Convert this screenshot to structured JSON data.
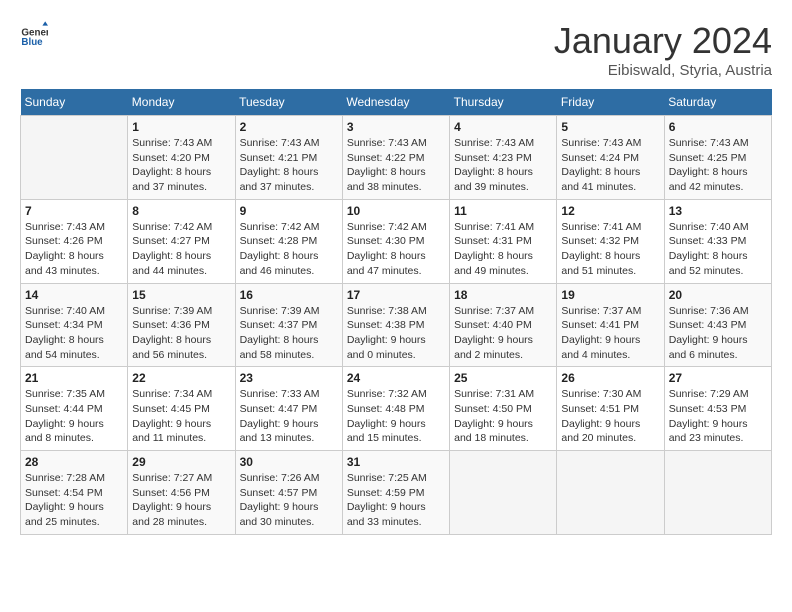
{
  "header": {
    "logo_general": "General",
    "logo_blue": "Blue",
    "month_title": "January 2024",
    "location": "Eibiswald, Styria, Austria"
  },
  "days_of_week": [
    "Sunday",
    "Monday",
    "Tuesday",
    "Wednesday",
    "Thursday",
    "Friday",
    "Saturday"
  ],
  "weeks": [
    [
      {
        "day": "",
        "sunrise": "",
        "sunset": "",
        "daylight": ""
      },
      {
        "day": "1",
        "sunrise": "Sunrise: 7:43 AM",
        "sunset": "Sunset: 4:20 PM",
        "daylight": "Daylight: 8 hours and 37 minutes."
      },
      {
        "day": "2",
        "sunrise": "Sunrise: 7:43 AM",
        "sunset": "Sunset: 4:21 PM",
        "daylight": "Daylight: 8 hours and 37 minutes."
      },
      {
        "day": "3",
        "sunrise": "Sunrise: 7:43 AM",
        "sunset": "Sunset: 4:22 PM",
        "daylight": "Daylight: 8 hours and 38 minutes."
      },
      {
        "day": "4",
        "sunrise": "Sunrise: 7:43 AM",
        "sunset": "Sunset: 4:23 PM",
        "daylight": "Daylight: 8 hours and 39 minutes."
      },
      {
        "day": "5",
        "sunrise": "Sunrise: 7:43 AM",
        "sunset": "Sunset: 4:24 PM",
        "daylight": "Daylight: 8 hours and 41 minutes."
      },
      {
        "day": "6",
        "sunrise": "Sunrise: 7:43 AM",
        "sunset": "Sunset: 4:25 PM",
        "daylight": "Daylight: 8 hours and 42 minutes."
      }
    ],
    [
      {
        "day": "7",
        "sunrise": "Sunrise: 7:43 AM",
        "sunset": "Sunset: 4:26 PM",
        "daylight": "Daylight: 8 hours and 43 minutes."
      },
      {
        "day": "8",
        "sunrise": "Sunrise: 7:42 AM",
        "sunset": "Sunset: 4:27 PM",
        "daylight": "Daylight: 8 hours and 44 minutes."
      },
      {
        "day": "9",
        "sunrise": "Sunrise: 7:42 AM",
        "sunset": "Sunset: 4:28 PM",
        "daylight": "Daylight: 8 hours and 46 minutes."
      },
      {
        "day": "10",
        "sunrise": "Sunrise: 7:42 AM",
        "sunset": "Sunset: 4:30 PM",
        "daylight": "Daylight: 8 hours and 47 minutes."
      },
      {
        "day": "11",
        "sunrise": "Sunrise: 7:41 AM",
        "sunset": "Sunset: 4:31 PM",
        "daylight": "Daylight: 8 hours and 49 minutes."
      },
      {
        "day": "12",
        "sunrise": "Sunrise: 7:41 AM",
        "sunset": "Sunset: 4:32 PM",
        "daylight": "Daylight: 8 hours and 51 minutes."
      },
      {
        "day": "13",
        "sunrise": "Sunrise: 7:40 AM",
        "sunset": "Sunset: 4:33 PM",
        "daylight": "Daylight: 8 hours and 52 minutes."
      }
    ],
    [
      {
        "day": "14",
        "sunrise": "Sunrise: 7:40 AM",
        "sunset": "Sunset: 4:34 PM",
        "daylight": "Daylight: 8 hours and 54 minutes."
      },
      {
        "day": "15",
        "sunrise": "Sunrise: 7:39 AM",
        "sunset": "Sunset: 4:36 PM",
        "daylight": "Daylight: 8 hours and 56 minutes."
      },
      {
        "day": "16",
        "sunrise": "Sunrise: 7:39 AM",
        "sunset": "Sunset: 4:37 PM",
        "daylight": "Daylight: 8 hours and 58 minutes."
      },
      {
        "day": "17",
        "sunrise": "Sunrise: 7:38 AM",
        "sunset": "Sunset: 4:38 PM",
        "daylight": "Daylight: 9 hours and 0 minutes."
      },
      {
        "day": "18",
        "sunrise": "Sunrise: 7:37 AM",
        "sunset": "Sunset: 4:40 PM",
        "daylight": "Daylight: 9 hours and 2 minutes."
      },
      {
        "day": "19",
        "sunrise": "Sunrise: 7:37 AM",
        "sunset": "Sunset: 4:41 PM",
        "daylight": "Daylight: 9 hours and 4 minutes."
      },
      {
        "day": "20",
        "sunrise": "Sunrise: 7:36 AM",
        "sunset": "Sunset: 4:43 PM",
        "daylight": "Daylight: 9 hours and 6 minutes."
      }
    ],
    [
      {
        "day": "21",
        "sunrise": "Sunrise: 7:35 AM",
        "sunset": "Sunset: 4:44 PM",
        "daylight": "Daylight: 9 hours and 8 minutes."
      },
      {
        "day": "22",
        "sunrise": "Sunrise: 7:34 AM",
        "sunset": "Sunset: 4:45 PM",
        "daylight": "Daylight: 9 hours and 11 minutes."
      },
      {
        "day": "23",
        "sunrise": "Sunrise: 7:33 AM",
        "sunset": "Sunset: 4:47 PM",
        "daylight": "Daylight: 9 hours and 13 minutes."
      },
      {
        "day": "24",
        "sunrise": "Sunrise: 7:32 AM",
        "sunset": "Sunset: 4:48 PM",
        "daylight": "Daylight: 9 hours and 15 minutes."
      },
      {
        "day": "25",
        "sunrise": "Sunrise: 7:31 AM",
        "sunset": "Sunset: 4:50 PM",
        "daylight": "Daylight: 9 hours and 18 minutes."
      },
      {
        "day": "26",
        "sunrise": "Sunrise: 7:30 AM",
        "sunset": "Sunset: 4:51 PM",
        "daylight": "Daylight: 9 hours and 20 minutes."
      },
      {
        "day": "27",
        "sunrise": "Sunrise: 7:29 AM",
        "sunset": "Sunset: 4:53 PM",
        "daylight": "Daylight: 9 hours and 23 minutes."
      }
    ],
    [
      {
        "day": "28",
        "sunrise": "Sunrise: 7:28 AM",
        "sunset": "Sunset: 4:54 PM",
        "daylight": "Daylight: 9 hours and 25 minutes."
      },
      {
        "day": "29",
        "sunrise": "Sunrise: 7:27 AM",
        "sunset": "Sunset: 4:56 PM",
        "daylight": "Daylight: 9 hours and 28 minutes."
      },
      {
        "day": "30",
        "sunrise": "Sunrise: 7:26 AM",
        "sunset": "Sunset: 4:57 PM",
        "daylight": "Daylight: 9 hours and 30 minutes."
      },
      {
        "day": "31",
        "sunrise": "Sunrise: 7:25 AM",
        "sunset": "Sunset: 4:59 PM",
        "daylight": "Daylight: 9 hours and 33 minutes."
      },
      {
        "day": "",
        "sunrise": "",
        "sunset": "",
        "daylight": ""
      },
      {
        "day": "",
        "sunrise": "",
        "sunset": "",
        "daylight": ""
      },
      {
        "day": "",
        "sunrise": "",
        "sunset": "",
        "daylight": ""
      }
    ]
  ]
}
